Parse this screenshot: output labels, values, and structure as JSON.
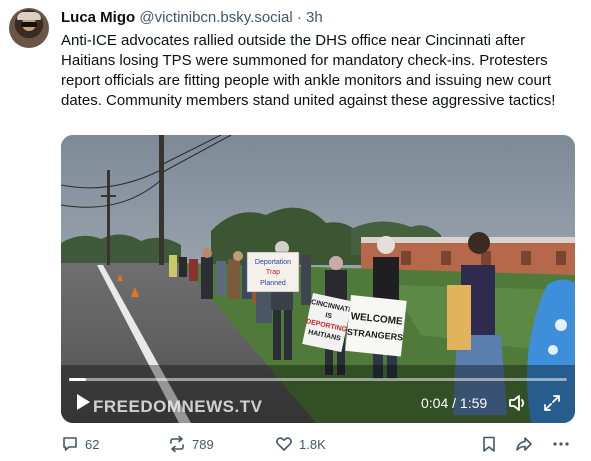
{
  "post": {
    "author_name": "Luca Migo",
    "handle": "@victinibcn.bsky.social",
    "separator": "·",
    "time": "3h",
    "text": "Anti-ICE advocates rallied outside the DHS office near Cincinnati after Haitians losing TPS were summoned for mandatory check-ins. Protesters report officials are fitting people with ankle monitors and issuing new court dates. Community members stand united against these aggressive tactics!"
  },
  "video": {
    "watermark": "FREEDOMNEWS.TV",
    "time_display": "0:04 / 1:59",
    "progress_fraction": 0.034,
    "signs": {
      "sign1": "Deportation Trap Planned",
      "sign2": "CINCINNATI IS DEPORTING HAITIANS",
      "sign3": "WELCOME STRANGERS"
    }
  },
  "actions": {
    "reply_count": "62",
    "repost_count": "789",
    "like_count": "1.8K"
  },
  "icons": {
    "reply": "reply-icon",
    "repost": "repost-icon",
    "like": "heart-icon",
    "bookmark": "bookmark-icon",
    "share": "share-icon",
    "more": "more-icon",
    "play": "play-icon",
    "mute": "volume-icon",
    "fullscreen": "fullscreen-icon"
  },
  "colors": {
    "text_primary": "#0b0f14",
    "text_secondary": "#42576c",
    "brand_blue": "#1083fe"
  }
}
